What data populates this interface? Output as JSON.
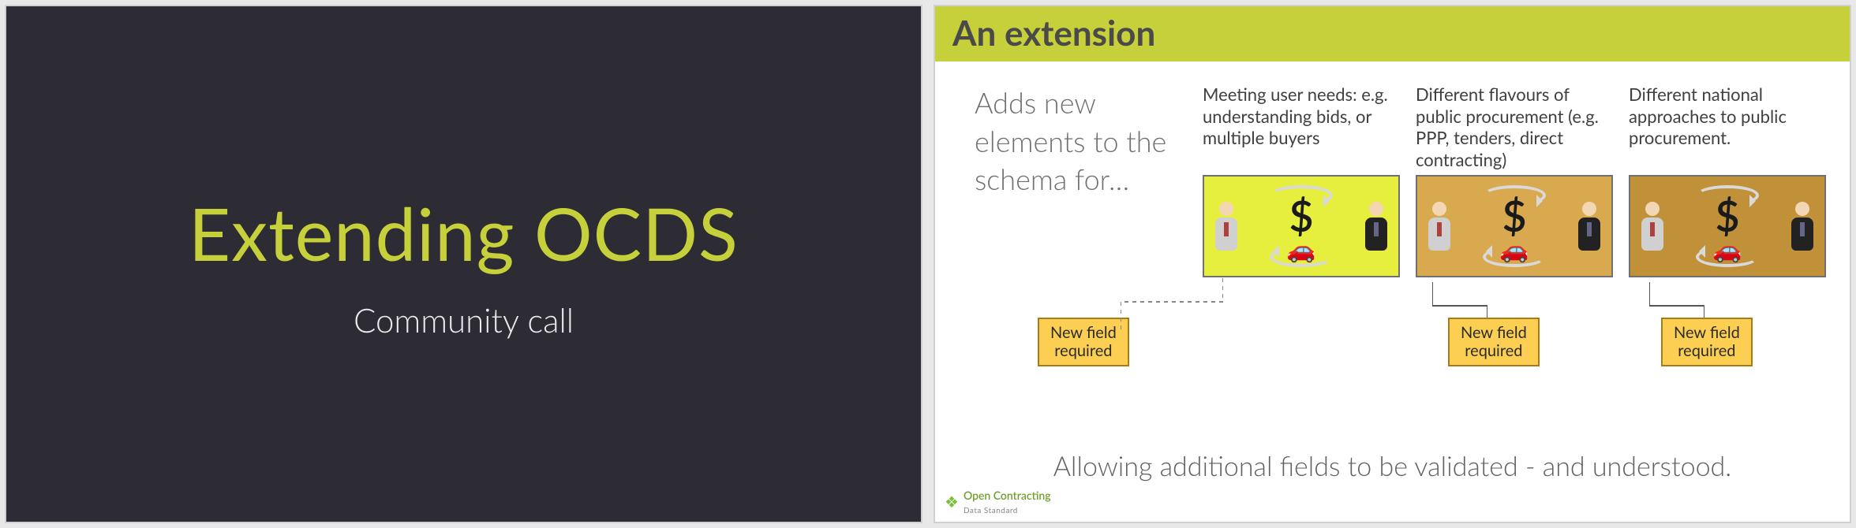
{
  "slide1": {
    "title": "Extending OCDS",
    "subtitle": "Community call"
  },
  "slide2": {
    "header": "An extension",
    "intro": "Adds new elements to the schema for…",
    "cols": [
      {
        "desc": "Meeting user needs: e.g. understanding bids, or multiple buyers",
        "variant": "yellow"
      },
      {
        "desc": "Different flavours of public procurement (e.g. PPP, tenders, direct contracting)",
        "variant": "tan"
      },
      {
        "desc": "Different national approaches to public procurement.",
        "variant": "gold"
      }
    ],
    "new_field_label": "New field\nrequired",
    "caption": "Allowing additional fields to be validated - and understood.",
    "footer": {
      "brand": "Open Contracting",
      "sub": "Data Standard"
    }
  }
}
